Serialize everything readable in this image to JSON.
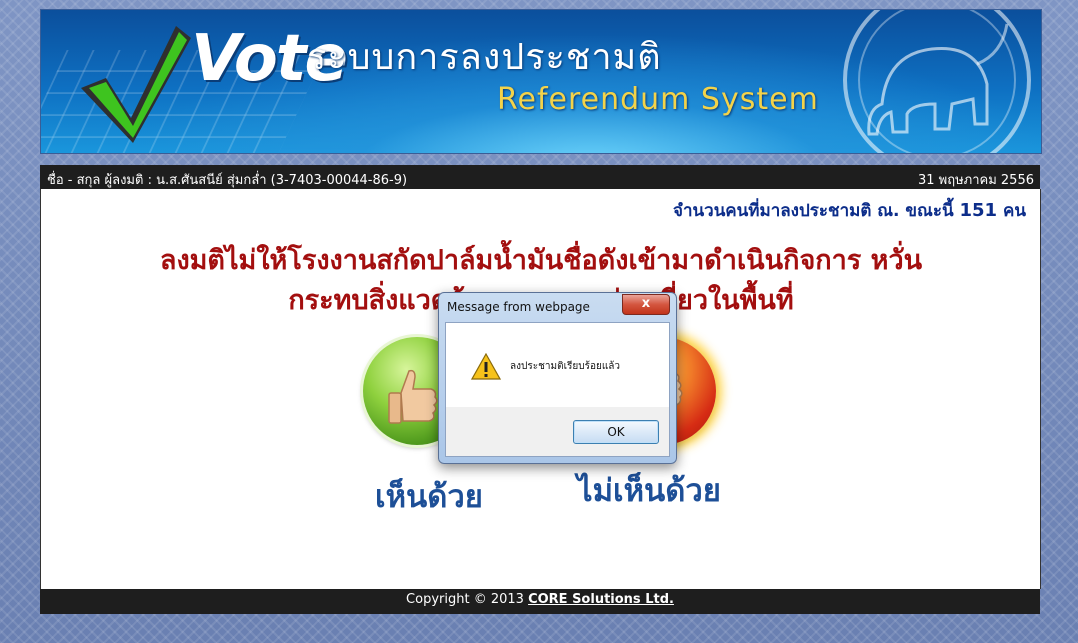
{
  "header": {
    "logo_text": "Vote",
    "title_thai": "ระบบการลงประชามติ",
    "title_en": "Referendum System"
  },
  "infobar": {
    "user": "ชื่อ - สกุล ผู้ลงมติ : น.ส.ศันสนีย์ สุ่มกล่ำ (3-7403-00044-86-9)",
    "date": "31 พฤษภาคม 2556"
  },
  "counter": {
    "label": "จำนวนคนที่มาลงประชามติ ณ. ขณะนี้",
    "count": "151",
    "unit": "คน"
  },
  "question": {
    "line1": "ลงมติไม่ให้โรงงานสกัดปาล์มน้ำมันชื่อดังเข้ามาดำเนินกิจการ หวั่น",
    "line2": "กระทบสิ่งแวดล้อม และการท่องเที่ยวในพื้นที่"
  },
  "vote": {
    "agree_label": "เห็นด้วย",
    "disagree_label": "ไม่เห็นด้วย",
    "agree_color": "#6fbf2f",
    "disagree_color": "#e0401c"
  },
  "footer": {
    "copyright": "Copyright © 2013",
    "company": "CORE Solutions Ltd."
  },
  "dialog": {
    "title": "Message from webpage",
    "close_symbol": "x",
    "message": "ลงประชามติเรียบร้อยแล้ว",
    "icon": "warning-icon",
    "ok_label": "OK"
  }
}
